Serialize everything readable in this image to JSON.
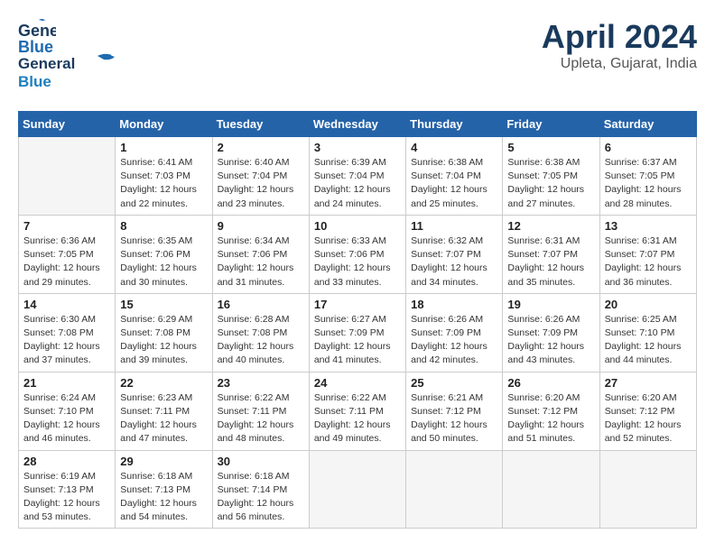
{
  "header": {
    "logo_line1": "General",
    "logo_line2": "Blue",
    "title": "April 2024",
    "subtitle": "Upleta, Gujarat, India"
  },
  "weekdays": [
    "Sunday",
    "Monday",
    "Tuesday",
    "Wednesday",
    "Thursday",
    "Friday",
    "Saturday"
  ],
  "weeks": [
    [
      {
        "day": "",
        "sunrise": "",
        "sunset": "",
        "daylight": ""
      },
      {
        "day": "1",
        "sunrise": "Sunrise: 6:41 AM",
        "sunset": "Sunset: 7:03 PM",
        "daylight": "Daylight: 12 hours and 22 minutes."
      },
      {
        "day": "2",
        "sunrise": "Sunrise: 6:40 AM",
        "sunset": "Sunset: 7:04 PM",
        "daylight": "Daylight: 12 hours and 23 minutes."
      },
      {
        "day": "3",
        "sunrise": "Sunrise: 6:39 AM",
        "sunset": "Sunset: 7:04 PM",
        "daylight": "Daylight: 12 hours and 24 minutes."
      },
      {
        "day": "4",
        "sunrise": "Sunrise: 6:38 AM",
        "sunset": "Sunset: 7:04 PM",
        "daylight": "Daylight: 12 hours and 25 minutes."
      },
      {
        "day": "5",
        "sunrise": "Sunrise: 6:38 AM",
        "sunset": "Sunset: 7:05 PM",
        "daylight": "Daylight: 12 hours and 27 minutes."
      },
      {
        "day": "6",
        "sunrise": "Sunrise: 6:37 AM",
        "sunset": "Sunset: 7:05 PM",
        "daylight": "Daylight: 12 hours and 28 minutes."
      }
    ],
    [
      {
        "day": "7",
        "sunrise": "Sunrise: 6:36 AM",
        "sunset": "Sunset: 7:05 PM",
        "daylight": "Daylight: 12 hours and 29 minutes."
      },
      {
        "day": "8",
        "sunrise": "Sunrise: 6:35 AM",
        "sunset": "Sunset: 7:06 PM",
        "daylight": "Daylight: 12 hours and 30 minutes."
      },
      {
        "day": "9",
        "sunrise": "Sunrise: 6:34 AM",
        "sunset": "Sunset: 7:06 PM",
        "daylight": "Daylight: 12 hours and 31 minutes."
      },
      {
        "day": "10",
        "sunrise": "Sunrise: 6:33 AM",
        "sunset": "Sunset: 7:06 PM",
        "daylight": "Daylight: 12 hours and 33 minutes."
      },
      {
        "day": "11",
        "sunrise": "Sunrise: 6:32 AM",
        "sunset": "Sunset: 7:07 PM",
        "daylight": "Daylight: 12 hours and 34 minutes."
      },
      {
        "day": "12",
        "sunrise": "Sunrise: 6:31 AM",
        "sunset": "Sunset: 7:07 PM",
        "daylight": "Daylight: 12 hours and 35 minutes."
      },
      {
        "day": "13",
        "sunrise": "Sunrise: 6:31 AM",
        "sunset": "Sunset: 7:07 PM",
        "daylight": "Daylight: 12 hours and 36 minutes."
      }
    ],
    [
      {
        "day": "14",
        "sunrise": "Sunrise: 6:30 AM",
        "sunset": "Sunset: 7:08 PM",
        "daylight": "Daylight: 12 hours and 37 minutes."
      },
      {
        "day": "15",
        "sunrise": "Sunrise: 6:29 AM",
        "sunset": "Sunset: 7:08 PM",
        "daylight": "Daylight: 12 hours and 39 minutes."
      },
      {
        "day": "16",
        "sunrise": "Sunrise: 6:28 AM",
        "sunset": "Sunset: 7:08 PM",
        "daylight": "Daylight: 12 hours and 40 minutes."
      },
      {
        "day": "17",
        "sunrise": "Sunrise: 6:27 AM",
        "sunset": "Sunset: 7:09 PM",
        "daylight": "Daylight: 12 hours and 41 minutes."
      },
      {
        "day": "18",
        "sunrise": "Sunrise: 6:26 AM",
        "sunset": "Sunset: 7:09 PM",
        "daylight": "Daylight: 12 hours and 42 minutes."
      },
      {
        "day": "19",
        "sunrise": "Sunrise: 6:26 AM",
        "sunset": "Sunset: 7:09 PM",
        "daylight": "Daylight: 12 hours and 43 minutes."
      },
      {
        "day": "20",
        "sunrise": "Sunrise: 6:25 AM",
        "sunset": "Sunset: 7:10 PM",
        "daylight": "Daylight: 12 hours and 44 minutes."
      }
    ],
    [
      {
        "day": "21",
        "sunrise": "Sunrise: 6:24 AM",
        "sunset": "Sunset: 7:10 PM",
        "daylight": "Daylight: 12 hours and 46 minutes."
      },
      {
        "day": "22",
        "sunrise": "Sunrise: 6:23 AM",
        "sunset": "Sunset: 7:11 PM",
        "daylight": "Daylight: 12 hours and 47 minutes."
      },
      {
        "day": "23",
        "sunrise": "Sunrise: 6:22 AM",
        "sunset": "Sunset: 7:11 PM",
        "daylight": "Daylight: 12 hours and 48 minutes."
      },
      {
        "day": "24",
        "sunrise": "Sunrise: 6:22 AM",
        "sunset": "Sunset: 7:11 PM",
        "daylight": "Daylight: 12 hours and 49 minutes."
      },
      {
        "day": "25",
        "sunrise": "Sunrise: 6:21 AM",
        "sunset": "Sunset: 7:12 PM",
        "daylight": "Daylight: 12 hours and 50 minutes."
      },
      {
        "day": "26",
        "sunrise": "Sunrise: 6:20 AM",
        "sunset": "Sunset: 7:12 PM",
        "daylight": "Daylight: 12 hours and 51 minutes."
      },
      {
        "day": "27",
        "sunrise": "Sunrise: 6:20 AM",
        "sunset": "Sunset: 7:12 PM",
        "daylight": "Daylight: 12 hours and 52 minutes."
      }
    ],
    [
      {
        "day": "28",
        "sunrise": "Sunrise: 6:19 AM",
        "sunset": "Sunset: 7:13 PM",
        "daylight": "Daylight: 12 hours and 53 minutes."
      },
      {
        "day": "29",
        "sunrise": "Sunrise: 6:18 AM",
        "sunset": "Sunset: 7:13 PM",
        "daylight": "Daylight: 12 hours and 54 minutes."
      },
      {
        "day": "30",
        "sunrise": "Sunrise: 6:18 AM",
        "sunset": "Sunset: 7:14 PM",
        "daylight": "Daylight: 12 hours and 56 minutes."
      },
      {
        "day": "",
        "sunrise": "",
        "sunset": "",
        "daylight": ""
      },
      {
        "day": "",
        "sunrise": "",
        "sunset": "",
        "daylight": ""
      },
      {
        "day": "",
        "sunrise": "",
        "sunset": "",
        "daylight": ""
      },
      {
        "day": "",
        "sunrise": "",
        "sunset": "",
        "daylight": ""
      }
    ]
  ]
}
